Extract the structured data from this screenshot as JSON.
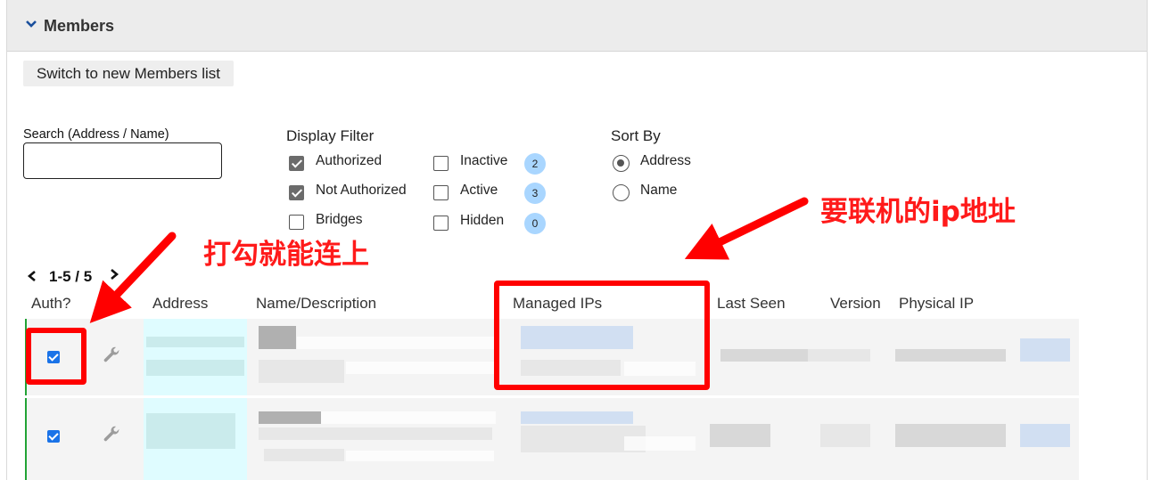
{
  "header": {
    "title": "Members"
  },
  "switch_button": "Switch to new Members list",
  "search": {
    "label": "Search (Address / Name)",
    "value": "",
    "placeholder": ""
  },
  "display_filter": {
    "title": "Display Filter",
    "options": [
      {
        "label": "Authorized",
        "checked": true
      },
      {
        "label": "Not Authorized",
        "checked": true
      },
      {
        "label": "Bridges",
        "checked": false
      },
      {
        "label": "Inactive",
        "checked": false,
        "count": "2"
      },
      {
        "label": "Active",
        "checked": false,
        "count": "3"
      },
      {
        "label": "Hidden",
        "checked": false,
        "count": "0"
      }
    ]
  },
  "sort_by": {
    "title": "Sort By",
    "options": [
      {
        "label": "Address",
        "selected": true
      },
      {
        "label": "Name",
        "selected": false
      }
    ]
  },
  "pagination": {
    "range": "1-5 / 5"
  },
  "table": {
    "columns": [
      "Auth?",
      "Address",
      "Name/Description",
      "Managed IPs",
      "Last Seen",
      "Version",
      "Physical IP"
    ],
    "rows": [
      {
        "authorized": true
      },
      {
        "authorized": true
      }
    ]
  },
  "annotations": {
    "auth_note": "打勾就能连上",
    "ip_note": "要联机的ip地址"
  },
  "colors": {
    "annotation_red": "#ff0000",
    "authorized_bar": "#22a336",
    "checkbox_blue": "#1a73e8",
    "badge": "#a9d6ff"
  }
}
